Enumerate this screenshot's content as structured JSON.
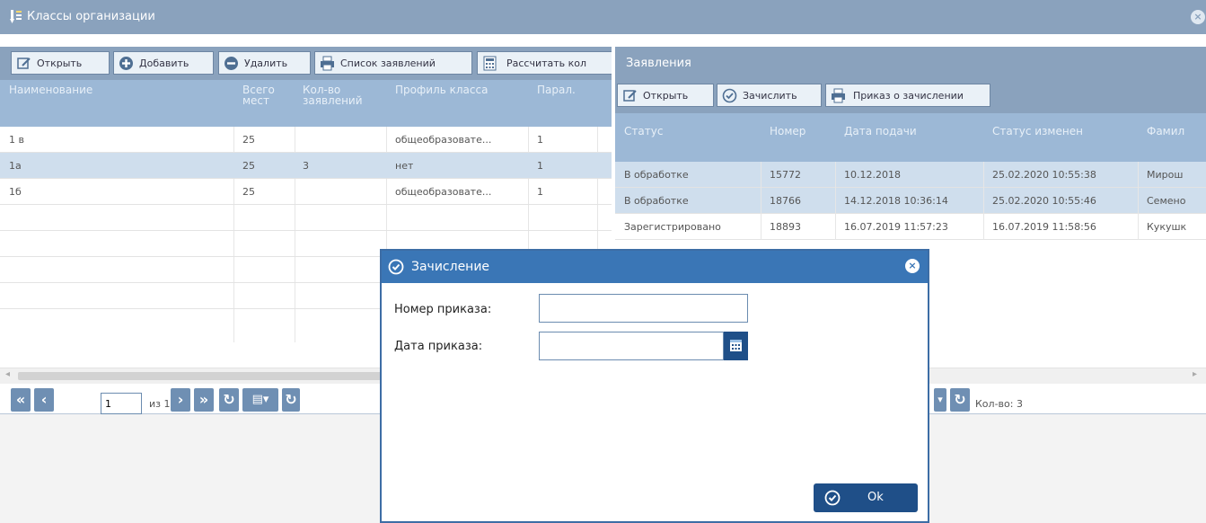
{
  "window": {
    "title": "Классы организации",
    "close_glyph": "×"
  },
  "left_toolbar": {
    "open_label": "Открыть",
    "add_label": "Добавить",
    "delete_label": "Удалить",
    "applications_list_label": "Список заявлений",
    "calculate_label": "Рассчитать кол"
  },
  "classes_grid": {
    "headers": [
      "Наименование",
      "Всего мест",
      "Кол-во заявлений",
      "Профиль класса",
      "Парал."
    ],
    "rows": [
      [
        "1 в",
        "25",
        "",
        "общеобразовате...",
        "1"
      ],
      [
        "1а",
        "25",
        "3",
        "нет",
        "1"
      ],
      [
        "1б",
        "25",
        "",
        "общеобразовате...",
        "1"
      ]
    ],
    "selected_row": 1
  },
  "right_panel": {
    "title": "Заявления",
    "open_label": "Открыть",
    "enroll_label": "Зачислить",
    "order_label": "Приказ о зачислении",
    "headers": [
      "Статус",
      "Номер",
      "Дата подачи",
      "Статус изменен",
      "Фамил"
    ],
    "rows": [
      [
        "В обработке",
        "15772",
        "10.12.2018",
        "25.02.2020 10:55:38",
        "Мирош"
      ],
      [
        "В обработке",
        "18766",
        "14.12.2018 10:36:14",
        "25.02.2020 10:55:46",
        "Семено"
      ],
      [
        "Зарегистрировано",
        "18893",
        "16.07.2019 11:57:23",
        "16.07.2019 11:58:56",
        "Кукушк"
      ]
    ],
    "count_label": "Кол-во: 3"
  },
  "pager": {
    "page_value": "1",
    "of_label": "из 1"
  },
  "dialog": {
    "title": "Зачисление",
    "order_number_label": "Номер приказа:",
    "order_number_value": "",
    "order_date_label": "Дата приказа:",
    "order_date_value": "",
    "ok_label": "Ok"
  },
  "colors": {
    "titlebar": "#8aa2bd",
    "grid_header": "#9cb8d6",
    "dialog_header": "#3a76b6",
    "ok_button": "#1f4f88"
  }
}
